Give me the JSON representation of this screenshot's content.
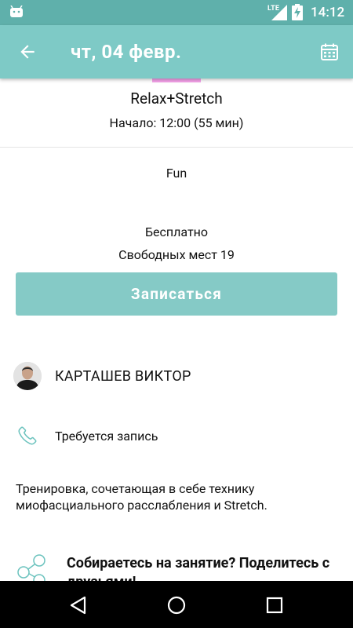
{
  "status_bar": {
    "network": "LTE",
    "time": "14:12"
  },
  "app_bar": {
    "title": "чт, 04 февр."
  },
  "event": {
    "class_name": "Relax+Stretch",
    "start_time": "Начало: 12:00 (55 мин)",
    "category": "Fun",
    "price": "Бесплатно",
    "free_spots": "Свободных мест 19",
    "signup_label": "Записаться"
  },
  "trainer": {
    "name": "КАРТАШЕВ ВИКТОР"
  },
  "booking": {
    "note": "Требуется запись"
  },
  "description": "Тренировка, сочетающая в себе технику миофасциального расслабления и Stretch.",
  "share": {
    "title": "Собираетесь на занятие? Поделитесь с друзьями!"
  },
  "colors": {
    "status_bar": "#5fb0ab",
    "app_bar": "#7ecac6",
    "button": "#85cac6",
    "accent": "#f5a2ea",
    "icon_teal": "#6cc3be"
  }
}
